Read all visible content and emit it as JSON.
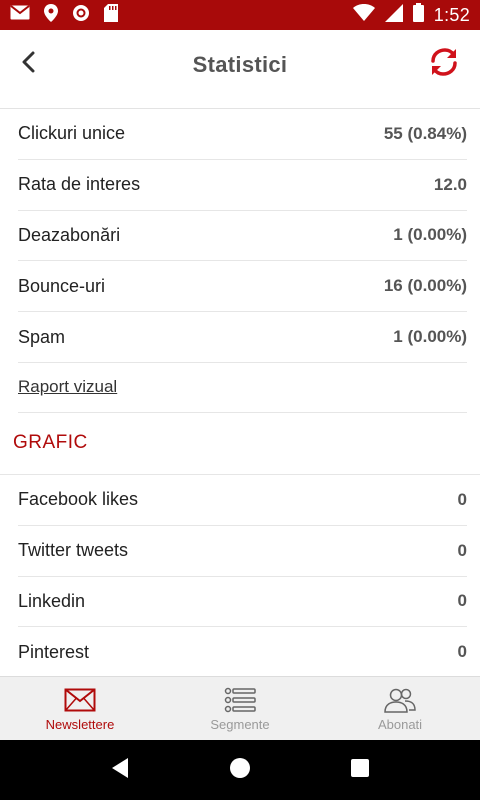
{
  "status_bar": {
    "time": "1:52",
    "icons": [
      "gmail-icon",
      "location-icon",
      "record-icon",
      "sd-card-icon",
      "wifi-icon",
      "signal-icon",
      "battery-icon"
    ]
  },
  "header": {
    "title": "Statistici",
    "back_icon": "back-arrow-icon",
    "refresh_icon": "refresh-icon"
  },
  "stats": [
    {
      "label": "Clickuri unice",
      "value": "55 (0.84%)"
    },
    {
      "label": "Rata de interes",
      "value": "12.0"
    },
    {
      "label": "Deazabonări",
      "value": "1 (0.00%)"
    },
    {
      "label": "Bounce-uri",
      "value": "16 (0.00%)"
    },
    {
      "label": "Spam",
      "value": "1 (0.00%)"
    }
  ],
  "visual_report_link": "Raport vizual",
  "section": {
    "title": "GRAFIC"
  },
  "social": [
    {
      "label": "Facebook likes",
      "value": "0"
    },
    {
      "label": "Twitter tweets",
      "value": "0"
    },
    {
      "label": "Linkedin",
      "value": "0"
    },
    {
      "label": "Pinterest",
      "value": "0"
    }
  ],
  "bottom_nav": [
    {
      "label": "Newslettere",
      "icon": "envelope-icon",
      "active": true
    },
    {
      "label": "Segmente",
      "icon": "list-icon",
      "active": false
    },
    {
      "label": "Abonati",
      "icon": "users-icon",
      "active": false
    }
  ],
  "colors": {
    "brand_red": "#b00b0b",
    "status_bar": "#a80a0a"
  }
}
